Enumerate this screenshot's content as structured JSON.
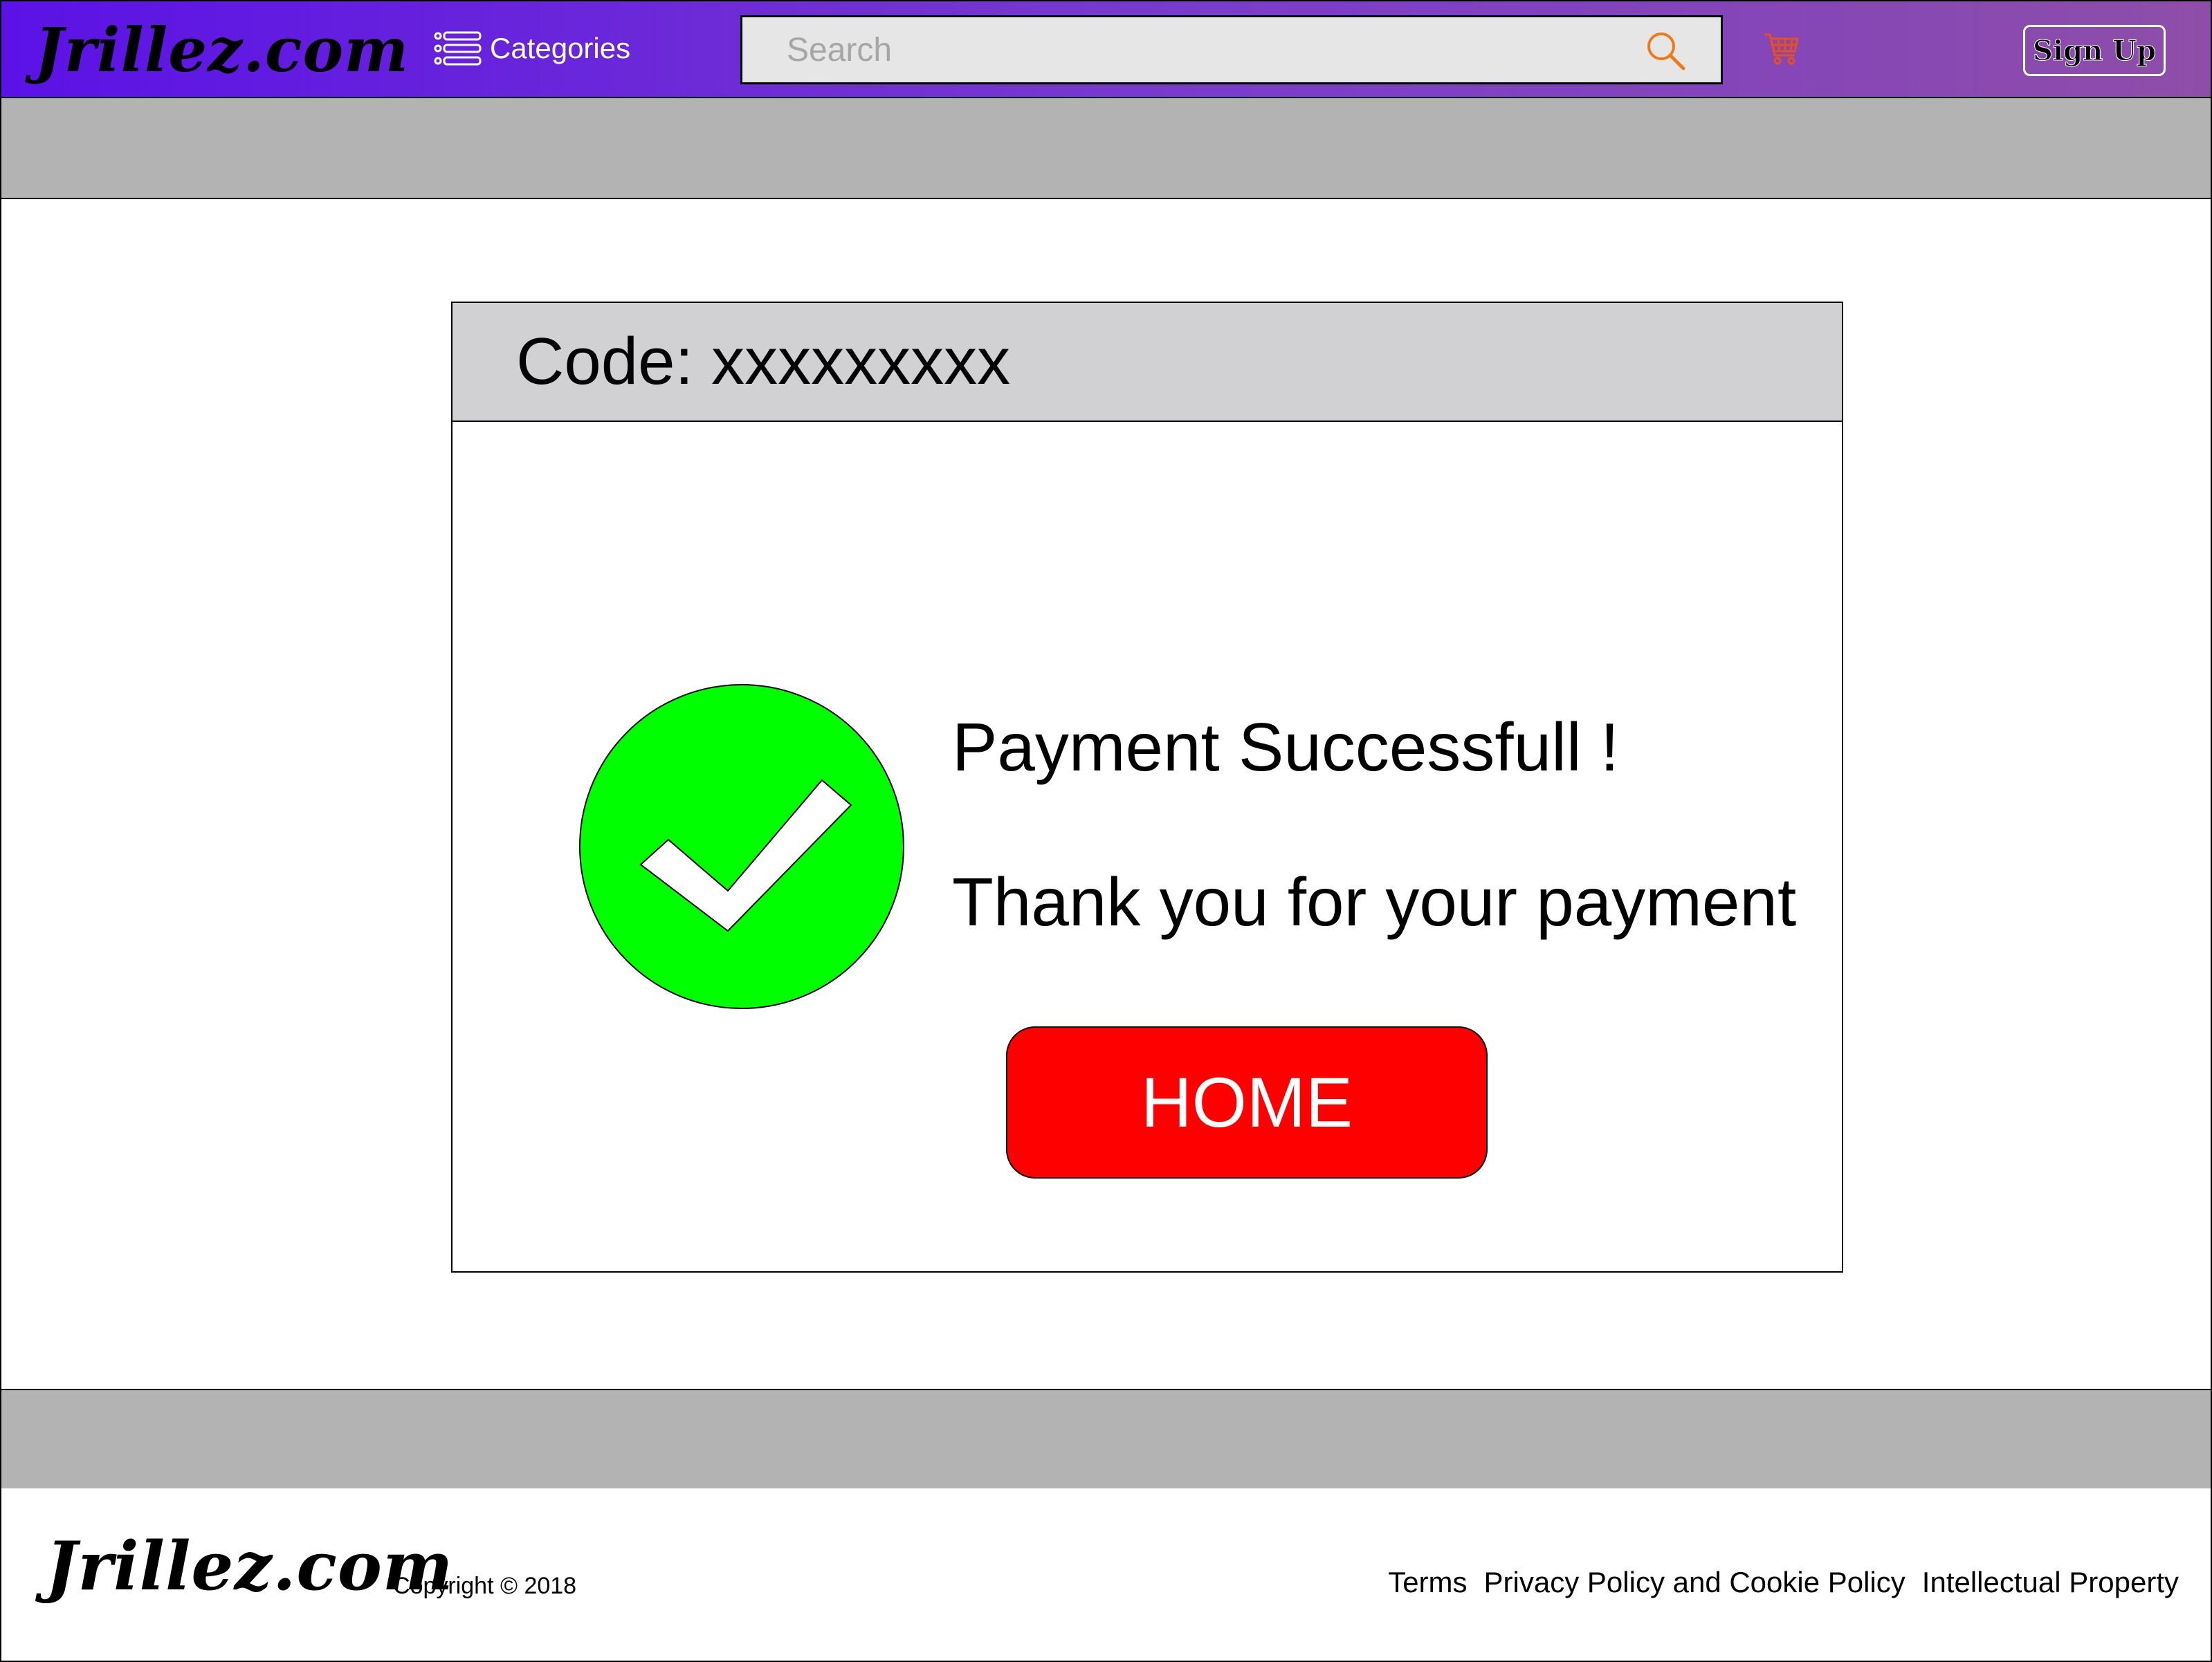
{
  "header": {
    "logo": "Jrillez.com",
    "categories_label": "Categories",
    "search_placeholder": "Search",
    "signup_label": "Sign Up"
  },
  "card": {
    "code_label": "Code:",
    "code_value": "xxxxxxxxx",
    "success_title": "Payment Successfull !",
    "thank_you": "Thank you for your payment",
    "home_button": "HOME"
  },
  "footer": {
    "logo": "Jrillez.com",
    "copyright": "Copyright © 2018",
    "links": [
      "Terms",
      "Privacy Policy and Cookie Policy",
      "Intellectual Property"
    ]
  },
  "colors": {
    "header_gradient_start": "#5b12e6",
    "header_gradient_end": "#8e4ea8",
    "success_green": "#00ff00",
    "home_red": "#ff0000",
    "search_icon": "#f07a1a",
    "cart_icon": "#e8501a"
  },
  "icons": {
    "categories": "list-icon",
    "search": "magnifier-icon",
    "cart": "shopping-cart-icon",
    "success": "check-circle-icon"
  }
}
